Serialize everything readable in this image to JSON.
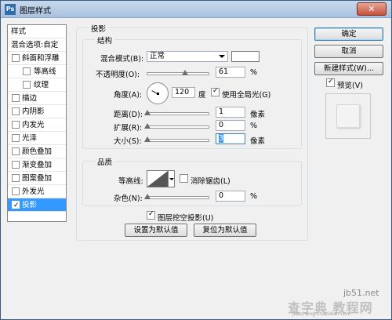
{
  "window": {
    "title": "图层样式",
    "close_label": "✕"
  },
  "sidebar": {
    "items": [
      {
        "label": "样式",
        "type": "header"
      },
      {
        "label": "混合选项:自定",
        "type": "plain"
      },
      {
        "label": "斜面和浮雕",
        "type": "check",
        "checked": false
      },
      {
        "label": "等高线",
        "type": "subcheck",
        "checked": false
      },
      {
        "label": "纹理",
        "type": "subcheck",
        "checked": false
      },
      {
        "label": "描边",
        "type": "check",
        "checked": false
      },
      {
        "label": "内阴影",
        "type": "check",
        "checked": false
      },
      {
        "label": "内发光",
        "type": "check",
        "checked": false
      },
      {
        "label": "光泽",
        "type": "check",
        "checked": false
      },
      {
        "label": "颜色叠加",
        "type": "check",
        "checked": false
      },
      {
        "label": "渐变叠加",
        "type": "check",
        "checked": false
      },
      {
        "label": "图案叠加",
        "type": "check",
        "checked": false
      },
      {
        "label": "外发光",
        "type": "check",
        "checked": false
      },
      {
        "label": "投影",
        "type": "check",
        "checked": true,
        "selected": true
      }
    ]
  },
  "drop_shadow": {
    "section_title": "投影",
    "structure": {
      "title": "结构",
      "blend_mode_label": "混合模式(B):",
      "blend_mode_value": "正常",
      "blend_color": "#ffffff",
      "opacity_label": "不透明度(O):",
      "opacity_value": "61",
      "opacity_unit": "%",
      "angle_label": "角度(A):",
      "angle_value": "120",
      "angle_unit": "度",
      "global_light_label": "使用全局光(G)",
      "global_light_checked": true,
      "distance_label": "距离(D):",
      "distance_value": "1",
      "distance_unit": "像素",
      "spread_label": "扩展(R):",
      "spread_value": "0",
      "spread_unit": "%",
      "size_label": "大小(S):",
      "size_value": "3",
      "size_unit": "像素"
    },
    "quality": {
      "title": "品质",
      "contour_label": "等高线:",
      "antialias_label": "消除锯齿(L)",
      "antialias_checked": false,
      "noise_label": "杂色(N):",
      "noise_value": "0",
      "noise_unit": "%"
    },
    "knockout_label": "图层挖空投影(U)",
    "knockout_checked": true,
    "make_default_label": "设置为默认值",
    "reset_default_label": "复位为默认值"
  },
  "buttons": {
    "ok": "确定",
    "cancel": "取消",
    "new_style": "新建样式(W)...",
    "preview_label": "预览(V)",
    "preview_checked": true
  },
  "watermark": {
    "line1": "jb51.net",
    "line2": "查字典 教程网",
    "line3": "jiaocheng.chazidian.com"
  }
}
